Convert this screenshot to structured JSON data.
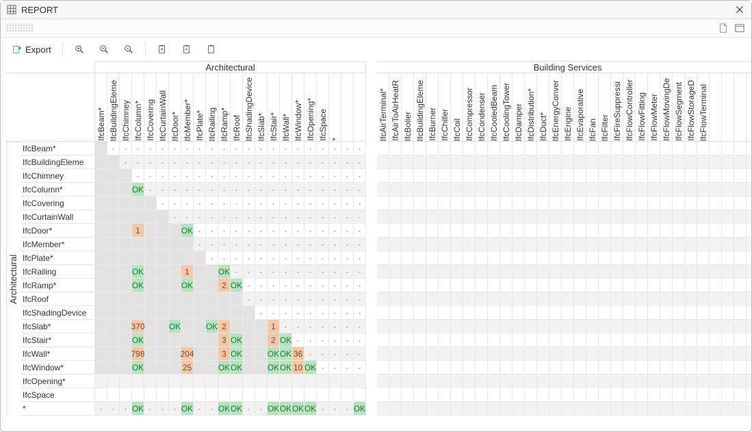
{
  "window": {
    "title": "REPORT"
  },
  "toolbar": {
    "export_label": "Export"
  },
  "groups": {
    "left": "Architectural",
    "right": "Building Services",
    "side": "Architectural"
  },
  "col_left": [
    "IfcBeam*",
    "IfcBuildingEleme",
    "IfcChimney",
    "IfcColumn*",
    "IfcCovering",
    "IfcCurtainWall",
    "IfcDoor*",
    "IfcMember*",
    "IfcPlate*",
    "IfcRailing",
    "IfcRamp*",
    "IfcRoof",
    "IfcShadingDevice",
    "IfcSlab*",
    "IfcStair*",
    "IfcWall*",
    "IfcWindow*",
    "IfcOpening*",
    "IfcSpace",
    "*"
  ],
  "col_right": [
    "IfcAirTerminal*",
    "IfcAirToAirHeatR",
    "IfcBoiler",
    "IfcBuildingEleme",
    "IfcBurner",
    "IfcChiller",
    "IfcCoil",
    "IfcCompressor",
    "IfcCondenser",
    "IfcCooledBeam",
    "IfcCoolingTower",
    "IfcDamper",
    "IfcDistribution*",
    "IfcDuct*",
    "IfcEnergyConver",
    "IfcEngine",
    "IfcEvaporative",
    "IfcFan",
    "IfcFilter",
    "IfcFireSuppressi",
    "IfcFlowController",
    "IfcFlowFitting",
    "IfcFlowMeter",
    "IfcFlowMovingDe",
    "IfcFlowSegment",
    "IfcFlowStorageD",
    "IfcFlowTerminal"
  ],
  "rows": [
    "IfcBeam*",
    "IfcBuildingEleme",
    "IfcChimney",
    "IfcColumn*",
    "IfcCovering",
    "IfcCurtainWall",
    "IfcDoor*",
    "IfcMember*",
    "IfcPlate*",
    "IfcRailing",
    "IfcRamp*",
    "IfcRoof",
    "IfcShadingDevice",
    "IfcSlab*",
    "IfcStair*",
    "IfcWall*",
    "IfcWindow*",
    "IfcOpening*",
    "IfcSpace",
    "*"
  ],
  "matrix": [
    [
      "d",
      "-",
      "-",
      "-",
      "-",
      "-",
      "-",
      "-",
      "-",
      "-",
      "-",
      "-",
      "-",
      "-",
      "-",
      "-",
      "-",
      "-",
      "-",
      "-",
      "-",
      "-"
    ],
    [
      "u",
      "d",
      "-",
      "-",
      "-",
      "-",
      "-",
      "-",
      "-",
      "-",
      "-",
      "-",
      "-",
      "-",
      "-",
      "-",
      "-",
      "-",
      "-",
      "-",
      "-",
      "-"
    ],
    [
      "u",
      "u",
      "d",
      "-",
      "-",
      "-",
      "-",
      "-",
      "-",
      "-",
      "-",
      "-",
      "-",
      "-",
      "-",
      "-",
      "-",
      "-",
      "-",
      "-",
      "-",
      "-"
    ],
    [
      "u",
      "u",
      "u",
      "OK",
      "-",
      "-",
      "-",
      "-",
      "-",
      "-",
      "-",
      "-",
      "-",
      "-",
      "-",
      "-",
      "-",
      "-",
      "-",
      "-",
      "-",
      "-"
    ],
    [
      "u",
      "u",
      "u",
      "u",
      "d",
      "-",
      "-",
      "-",
      "-",
      "-",
      "-",
      "-",
      "-",
      "-",
      "-",
      "-",
      "-",
      "-",
      "-",
      "-",
      "-",
      "-"
    ],
    [
      "u",
      "u",
      "u",
      "u",
      "u",
      "d",
      "-",
      "-",
      "-",
      "-",
      "-",
      "-",
      "-",
      "-",
      "-",
      "-",
      "-",
      "-",
      "-",
      "-",
      "-",
      "-"
    ],
    [
      "u",
      "u",
      "u",
      "1",
      "u",
      "u",
      "d",
      "OK",
      "-",
      "-",
      "-",
      "-",
      "-",
      "-",
      "-",
      "-",
      "-",
      "-",
      "-",
      "-",
      "-",
      "-"
    ],
    [
      "u",
      "u",
      "u",
      "u",
      "u",
      "u",
      "u",
      "d",
      "-",
      "-",
      "-",
      "-",
      "-",
      "-",
      "-",
      "-",
      "-",
      "-",
      "-",
      "-",
      "-",
      "-"
    ],
    [
      "u",
      "u",
      "u",
      "u",
      "u",
      "u",
      "u",
      "u",
      "d",
      "-",
      "-",
      "-",
      "-",
      "-",
      "-",
      "-",
      "-",
      "-",
      "-",
      "-",
      "-",
      "-"
    ],
    [
      "u",
      "u",
      "u",
      "OK",
      "u",
      "u",
      "u",
      "1",
      "u",
      "d",
      "OK",
      "-",
      "-",
      "-",
      "-",
      "-",
      "-",
      "-",
      "-",
      "-",
      "-",
      "-"
    ],
    [
      "u",
      "u",
      "u",
      "OK",
      "u",
      "u",
      "u",
      "OK",
      "u",
      "u",
      "2",
      "OK",
      "-",
      "-",
      "-",
      "-",
      "-",
      "-",
      "-",
      "-",
      "-",
      "-"
    ],
    [
      "u",
      "u",
      "u",
      "u",
      "u",
      "u",
      "u",
      "u",
      "u",
      "u",
      "u",
      "d",
      "-",
      "-",
      "-",
      "-",
      "-",
      "-",
      "-",
      "-",
      "-",
      "-"
    ],
    [
      "u",
      "u",
      "u",
      "u",
      "u",
      "u",
      "u",
      "u",
      "u",
      "u",
      "u",
      "u",
      "d",
      "-",
      "-",
      "-",
      "-",
      "-",
      "-",
      "-",
      "-",
      "-"
    ],
    [
      "u",
      "u",
      "u",
      "370",
      "u",
      "u",
      "OK",
      "u",
      "u",
      "OK",
      "2",
      "u",
      "u",
      "d",
      "1",
      "-",
      "-",
      "-",
      "-",
      "-",
      "-",
      "-"
    ],
    [
      "u",
      "u",
      "u",
      "OK",
      "u",
      "u",
      "u",
      "u",
      "u",
      "u",
      "3",
      "OK",
      "u",
      "u",
      "2",
      "OK",
      "-",
      "-",
      "-",
      "-",
      "-",
      "-"
    ],
    [
      "u",
      "u",
      "u",
      "798",
      "u",
      "u",
      "u",
      "204",
      "u",
      "u",
      "3",
      "OK",
      "u",
      "u",
      "OK",
      "OK",
      "36",
      "-",
      "-",
      "-",
      "-",
      "-"
    ],
    [
      "u",
      "u",
      "u",
      "OK",
      "u",
      "u",
      "u",
      "25",
      "u",
      "u",
      "OK",
      "OK",
      "u",
      "u",
      "OK",
      "OK",
      "10",
      "OK",
      "-",
      "-",
      "-",
      "-"
    ],
    [
      "",
      "",
      "",
      "",
      "",
      "",
      "",
      "",
      "",
      "",
      "",
      "",
      "",
      "",
      "",
      "",
      "",
      "",
      "",
      "",
      "",
      ""
    ],
    [
      "",
      "",
      "",
      "",
      "",
      "",
      "",
      "",
      "",
      "",
      "",
      "",
      "",
      "",
      "",
      "",
      "",
      "",
      "",
      "",
      "",
      ""
    ],
    [
      "-",
      "-",
      "-",
      "OK",
      "-",
      "-",
      "-",
      "OK",
      "-",
      "-",
      "OK",
      "OK",
      "-",
      "-",
      "OK",
      "OK",
      "OK",
      "OK",
      "-",
      "-",
      "-",
      "OK"
    ]
  ],
  "chart_data": {
    "type": "table",
    "title": "REPORT",
    "row_group": "Architectural",
    "column_groups": [
      "Architectural",
      "Building Services"
    ],
    "left_columns": [
      "IfcBeam*",
      "IfcBuildingEleme",
      "IfcChimney",
      "IfcColumn*",
      "IfcCovering",
      "IfcCurtainWall",
      "IfcDoor*",
      "IfcMember*",
      "IfcPlate*",
      "IfcRailing",
      "IfcRamp*",
      "IfcRoof",
      "IfcShadingDevice",
      "IfcSlab*",
      "IfcStair*",
      "IfcWall*",
      "IfcWindow*",
      "IfcOpening*",
      "IfcSpace",
      "*"
    ],
    "right_columns": [
      "IfcAirTerminal*",
      "IfcAirToAirHeatR",
      "IfcBoiler",
      "IfcBuildingEleme",
      "IfcBurner",
      "IfcChiller",
      "IfcCoil",
      "IfcCompressor",
      "IfcCondenser",
      "IfcCooledBeam",
      "IfcCoolingTower",
      "IfcDamper",
      "IfcDistribution*",
      "IfcDuct*",
      "IfcEnergyConver",
      "IfcEngine",
      "IfcEvaporative",
      "IfcFan",
      "IfcFilter",
      "IfcFireSuppressi",
      "IfcFlowController",
      "IfcFlowFitting",
      "IfcFlowMeter",
      "IfcFlowMovingDe",
      "IfcFlowSegment",
      "IfcFlowStorageD",
      "IfcFlowTerminal"
    ],
    "rows": [
      "IfcBeam*",
      "IfcBuildingEleme",
      "IfcChimney",
      "IfcColumn*",
      "IfcCovering",
      "IfcCurtainWall",
      "IfcDoor*",
      "IfcMember*",
      "IfcPlate*",
      "IfcRailing",
      "IfcRamp*",
      "IfcRoof",
      "IfcShadingDevice",
      "IfcSlab*",
      "IfcStair*",
      "IfcWall*",
      "IfcWindow*",
      "IfcOpening*",
      "IfcSpace",
      "*"
    ],
    "ok_cells": [
      [
        "IfcColumn*",
        "IfcColumn*"
      ],
      [
        "IfcDoor*",
        "IfcMember*"
      ],
      [
        "IfcRailing",
        "IfcColumn*"
      ],
      [
        "IfcRailing",
        "IfcRamp*"
      ],
      [
        "IfcRamp*",
        "IfcColumn*"
      ],
      [
        "IfcRamp*",
        "IfcMember*"
      ],
      [
        "IfcRamp*",
        "IfcRoof"
      ],
      [
        "IfcSlab*",
        "IfcDoor*"
      ],
      [
        "IfcSlab*",
        "IfcRailing"
      ],
      [
        "IfcStair*",
        "IfcColumn*"
      ],
      [
        "IfcStair*",
        "IfcRoof"
      ],
      [
        "IfcStair*",
        "IfcWall*"
      ],
      [
        "IfcWall*",
        "IfcRoof"
      ],
      [
        "IfcWall*",
        "IfcStair*"
      ],
      [
        "IfcWall*",
        "IfcWall*"
      ],
      [
        "IfcWindow*",
        "IfcColumn*"
      ],
      [
        "IfcWindow*",
        "IfcRamp*"
      ],
      [
        "IfcWindow*",
        "IfcRoof"
      ],
      [
        "IfcWindow*",
        "IfcStair*"
      ],
      [
        "IfcWindow*",
        "IfcWall*"
      ],
      [
        "IfcWindow*",
        "IfcOpening*"
      ],
      [
        "*",
        "IfcColumn*"
      ],
      [
        "*",
        "IfcMember*"
      ],
      [
        "*",
        "IfcRamp*"
      ],
      [
        "*",
        "IfcRoof"
      ],
      [
        "*",
        "IfcStair*"
      ],
      [
        "*",
        "IfcWall*"
      ],
      [
        "*",
        "IfcWindow*"
      ],
      [
        "*",
        "IfcOpening*"
      ],
      [
        "*",
        "*"
      ]
    ],
    "number_cells": [
      {
        "row": "IfcDoor*",
        "col": "IfcColumn*",
        "value": 1
      },
      {
        "row": "IfcRailing",
        "col": "IfcMember*",
        "value": 1
      },
      {
        "row": "IfcRamp*",
        "col": "IfcRamp*",
        "value": 2
      },
      {
        "row": "IfcSlab*",
        "col": "IfcColumn*",
        "value": 370
      },
      {
        "row": "IfcSlab*",
        "col": "IfcRamp*",
        "value": 2
      },
      {
        "row": "IfcSlab*",
        "col": "IfcStair*",
        "value": 1
      },
      {
        "row": "IfcStair*",
        "col": "IfcRamp*",
        "value": 3
      },
      {
        "row": "IfcStair*",
        "col": "IfcStair*",
        "value": 2
      },
      {
        "row": "IfcWall*",
        "col": "IfcColumn*",
        "value": 798
      },
      {
        "row": "IfcWall*",
        "col": "IfcMember*",
        "value": 204
      },
      {
        "row": "IfcWall*",
        "col": "IfcRamp*",
        "value": 3
      },
      {
        "row": "IfcWall*",
        "col": "IfcWindow*",
        "value": 36
      },
      {
        "row": "IfcWindow*",
        "col": "IfcMember*",
        "value": 25
      },
      {
        "row": "IfcWindow*",
        "col": "IfcWindow*",
        "value": 10
      }
    ]
  }
}
